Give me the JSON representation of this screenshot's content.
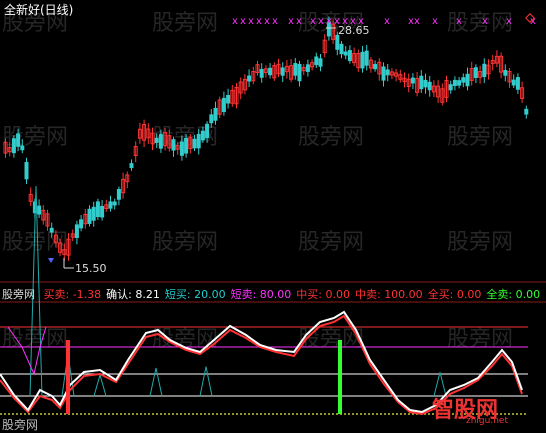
{
  "window": {
    "title": "全新好(日线)",
    "watermark": "股旁网"
  },
  "price_panel": {
    "high_label": "28.65",
    "low_label": "15.50",
    "signal_marker": "x"
  },
  "indicator_panel": {
    "name": "股旁网",
    "items": [
      {
        "label": "买卖:",
        "value": "-1.38",
        "color": "#ff3333"
      },
      {
        "label": "确认:",
        "value": "8.21",
        "color": "#ffffff"
      },
      {
        "label": "短买:",
        "value": "20.00",
        "color": "#22cccc"
      },
      {
        "label": "短卖:",
        "value": "80.00",
        "color": "#ff33ff"
      },
      {
        "label": "中买:",
        "value": "0.00",
        "color": "#ff3333"
      },
      {
        "label": "中卖:",
        "value": "100.00",
        "color": "#ff3333"
      },
      {
        "label": "全买:",
        "value": "0.00",
        "color": "#ff3333"
      },
      {
        "label": "全卖:",
        "value": "0.00",
        "color": "#33ff33"
      }
    ],
    "bottom_label": "股旁网"
  },
  "logo": {
    "text": "智股网",
    "sub": "zhigu.net"
  },
  "colors": {
    "up": "#ff3333",
    "down": "#33cccc",
    "magenta": "#ff33ff",
    "green": "#33ff33",
    "cyan": "#22aaaa",
    "white": "#ffffff",
    "red_line": "#ff3333"
  }
}
